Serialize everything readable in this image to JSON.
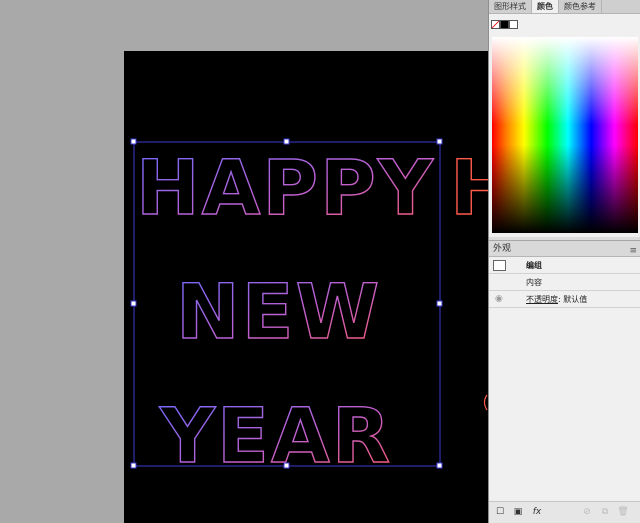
{
  "color_panel": {
    "tabs": [
      "图形样式",
      "颜色",
      "颜色参考"
    ],
    "active_tab": "颜色",
    "menu_icon": "panel-menu-icon"
  },
  "appearance_panel": {
    "title": "外观",
    "group_label": "编组",
    "contents_label": "内容",
    "opacity_label": "不透明度",
    "opacity_value": "默认值"
  },
  "canvas": {
    "lines": [
      "HAPPY",
      "NEW",
      "YEAR"
    ],
    "next_line_fragment": "H"
  },
  "colors": {
    "artboard": "#000000",
    "pasteboard": "#a9a9a9",
    "selection": "#3a3ad0",
    "text_stroke_start": "#9a5cff",
    "text_stroke_end": "#ff5a6a"
  }
}
